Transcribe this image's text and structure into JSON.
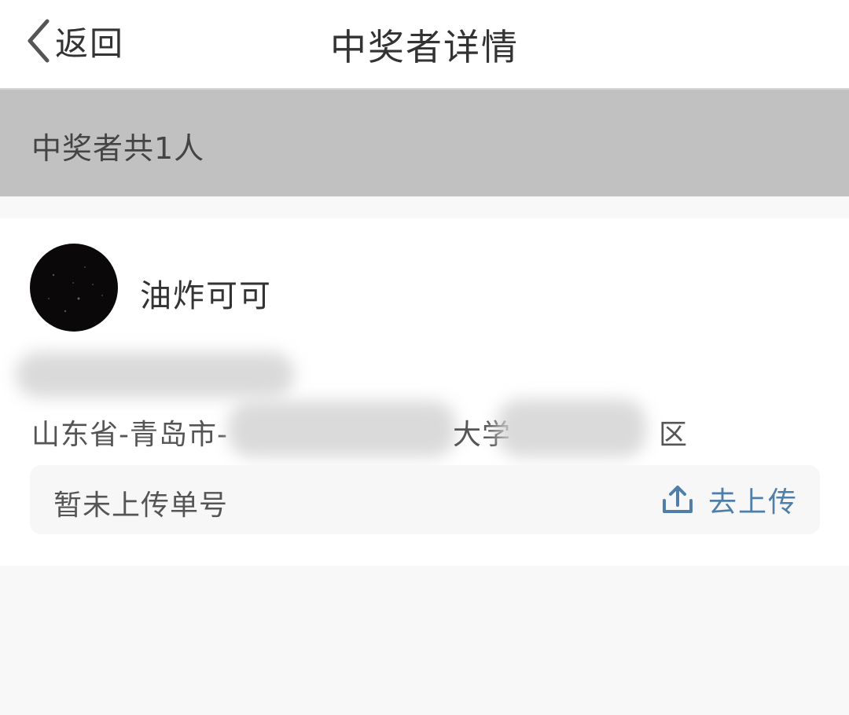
{
  "nav": {
    "back_label": "返回",
    "title": "中奖者详情"
  },
  "banner": {
    "count_text": "中奖者共1人"
  },
  "winner": {
    "name": "油炸可可",
    "avatar_icon": "avatar-image",
    "address": "山东省-青岛市-",
    "address_mid": "大学",
    "address_end": "区",
    "tracking": {
      "status": "暂未上传单号",
      "upload_label": "去上传",
      "upload_icon": "upload-icon"
    }
  },
  "colors": {
    "accent": "#4f7fa8",
    "banner": "#c1c1c1",
    "text": "#333333",
    "page_bg": "#f8f8f8"
  }
}
